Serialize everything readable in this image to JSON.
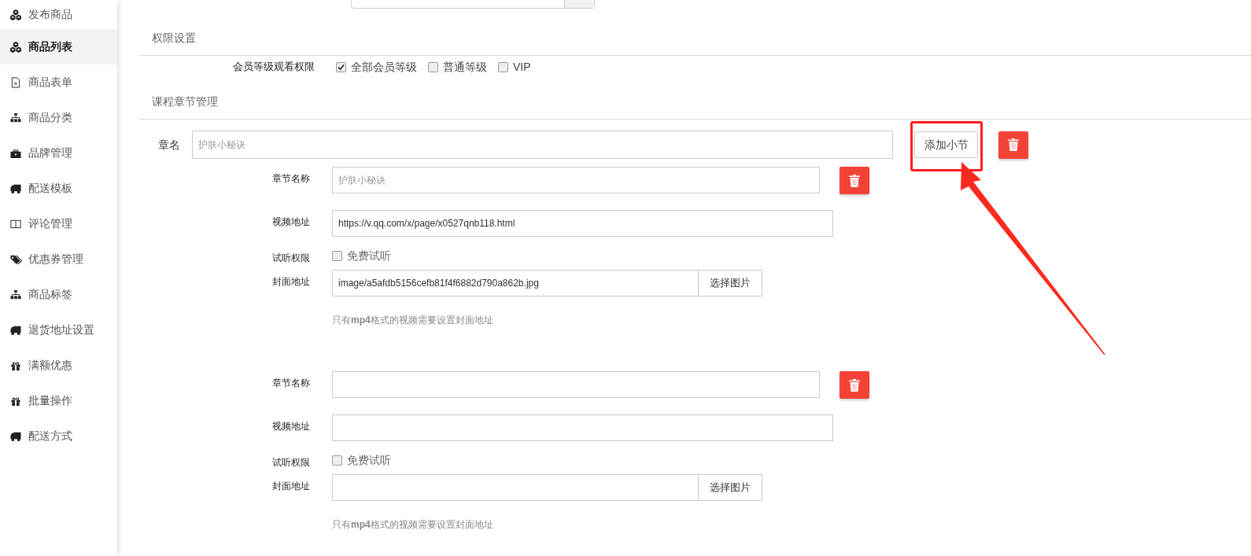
{
  "sidebar": {
    "items": [
      {
        "label": "发布商品",
        "kind": "cubes",
        "selected": false
      },
      {
        "label": "商品列表",
        "kind": "cubes",
        "selected": true
      },
      {
        "label": "商品表单",
        "kind": "file",
        "selected": false
      },
      {
        "label": "商品分类",
        "kind": "sitemap",
        "selected": false
      },
      {
        "label": "品牌管理",
        "kind": "briefcase",
        "selected": false
      },
      {
        "label": "配送模板",
        "kind": "truck",
        "selected": false
      },
      {
        "label": "评论管理",
        "kind": "columns",
        "selected": false
      },
      {
        "label": "优惠券管理",
        "kind": "tags",
        "selected": false
      },
      {
        "label": "商品标签",
        "kind": "sitemap",
        "selected": false
      },
      {
        "label": "退货地址设置",
        "kind": "truck",
        "selected": false
      },
      {
        "label": "满额优惠",
        "kind": "gift",
        "selected": false
      },
      {
        "label": "批量操作",
        "kind": "gift",
        "selected": false
      },
      {
        "label": "配送方式",
        "kind": "truck",
        "selected": false
      }
    ]
  },
  "permissions": {
    "heading": "权限设置",
    "label": "会员等级观看权限",
    "options": [
      {
        "label": "全部会员等级",
        "checked": true
      },
      {
        "label": "普通等级",
        "checked": false
      },
      {
        "label": "VIP",
        "checked": false
      }
    ]
  },
  "chapters": {
    "heading": "课程章节管理",
    "chapter": {
      "label": "章名",
      "placeholder": "护肤小秘诀",
      "add_button": "添加小节"
    },
    "sections": [
      {
        "name_label": "章节名称",
        "name_placeholder": "护肤小秘诀",
        "video_label": "视频地址",
        "video_value": "https://v.qq.com/x/page/x0527qnb118.html",
        "trial_label": "试听权限",
        "trial_option": "免费试听",
        "trial_checked": false,
        "cover_label": "封面地址",
        "cover_value": "image/a5afdb5156cefb81f4f6882d790a862b.jpg",
        "cover_button": "选择图片",
        "hint": "只有**mp4**格式的视频需要设置封面地址"
      },
      {
        "name_label": "章节名称",
        "video_label": "视频地址",
        "trial_label": "试听权限",
        "trial_option": "免费试听",
        "trial_checked": false,
        "cover_label": "封面地址",
        "cover_button": "选择图片",
        "hint": "只有**mp4**格式的视频需要设置封面地址"
      }
    ]
  }
}
